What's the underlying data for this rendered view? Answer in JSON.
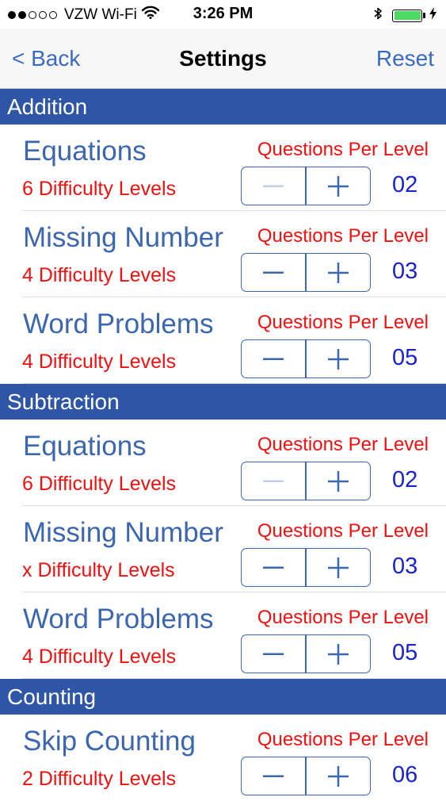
{
  "status_bar": {
    "carrier": "VZW Wi-Fi",
    "time": "3:26 PM",
    "signal_bars_filled": 2,
    "signal_bars_total": 5,
    "battery_color": "#4cd964",
    "icons": [
      "wifi-icon",
      "bluetooth-icon",
      "battery-icon",
      "charging-bolt-icon"
    ]
  },
  "nav": {
    "back_label": "< Back",
    "title": "Settings",
    "reset_label": "Reset"
  },
  "colors": {
    "section_header_bg": "#2f56a6",
    "title_text": "#3c66ae",
    "red_text": "#ee1111",
    "value_text": "#1a22cc"
  },
  "sections": [
    {
      "header": "Addition",
      "rows": [
        {
          "title": "Equations",
          "subtitle": "6 Difficulty Levels",
          "qpl_label": "Questions Per Level",
          "value": "02",
          "minus_disabled": true
        },
        {
          "title": "Missing Number",
          "subtitle": "4 Difficulty Levels",
          "qpl_label": "Questions Per Level",
          "value": "03",
          "minus_disabled": false
        },
        {
          "title": "Word Problems",
          "subtitle": "4 Difficulty Levels",
          "qpl_label": "Questions Per Level",
          "value": "05",
          "minus_disabled": false
        }
      ]
    },
    {
      "header": "Subtraction",
      "rows": [
        {
          "title": "Equations",
          "subtitle": "6 Difficulty Levels",
          "qpl_label": "Questions Per Level",
          "value": "02",
          "minus_disabled": true
        },
        {
          "title": "Missing Number",
          "subtitle": "x Difficulty Levels",
          "qpl_label": "Questions Per Level",
          "value": "03",
          "minus_disabled": false
        },
        {
          "title": "Word Problems",
          "subtitle": "4 Difficulty Levels",
          "qpl_label": "Questions Per Level",
          "value": "05",
          "minus_disabled": false
        }
      ]
    },
    {
      "header": "Counting",
      "rows": [
        {
          "title": "Skip Counting",
          "subtitle": "2 Difficulty Levels",
          "qpl_label": "Questions Per Level",
          "value": "06",
          "minus_disabled": false
        }
      ]
    }
  ]
}
